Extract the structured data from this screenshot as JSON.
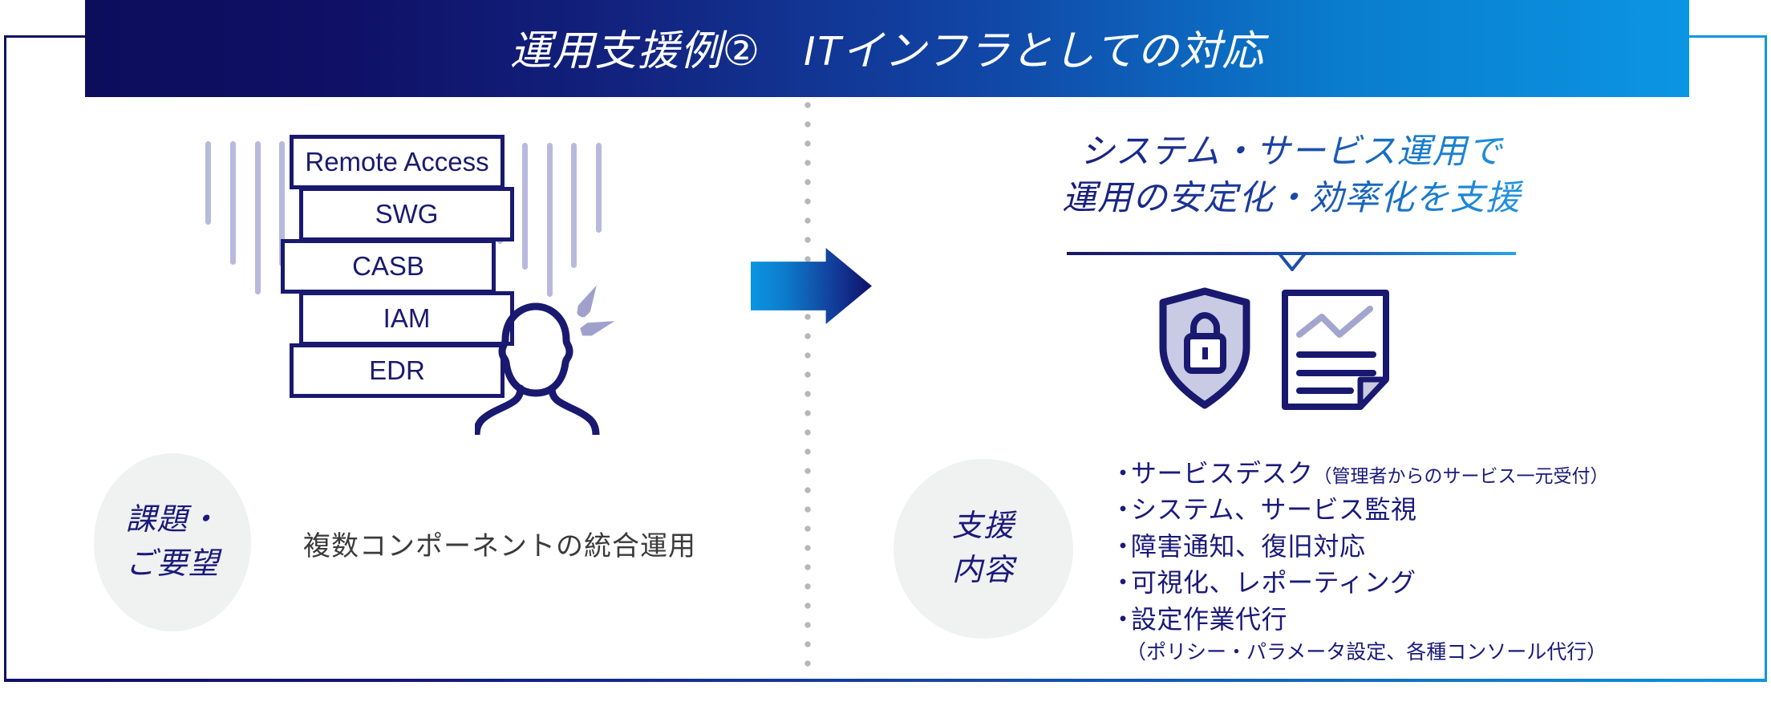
{
  "header": {
    "title": "運用支援例②　ITインフラとしての対応",
    "gradient_from": "#0d0d5c",
    "gradient_to": "#0b95e3"
  },
  "left": {
    "stack": [
      {
        "label": "Remote Access"
      },
      {
        "label": "SWG"
      },
      {
        "label": "CASB"
      },
      {
        "label": "IAM"
      },
      {
        "label": "EDR"
      }
    ],
    "circle": {
      "line1": "課題・",
      "line2": "ご要望"
    },
    "description": "複数コンポーネントの統合運用",
    "person_icon": "worried-person-icon",
    "rain_icon": "rain-lines-icon",
    "sweat_icon": "sweat-drop-icon"
  },
  "arrow": {
    "name": "right-arrow",
    "gradient_from": "#0b95e3",
    "gradient_to": "#0f1068"
  },
  "right": {
    "headline_line1": "システム・サービス運用で",
    "headline_line2": "運用の安定化・効率化を支援",
    "icons": [
      "shield-lock-icon",
      "report-document-icon"
    ],
    "circle": {
      "line1": "支援",
      "line2": "内容"
    },
    "bullets": [
      {
        "marker": "・",
        "text": "サービスデスク",
        "sub": "（管理者からのサービス一元受付）",
        "note": ""
      },
      {
        "marker": "・",
        "text": "システム、サービス監視",
        "sub": "",
        "note": ""
      },
      {
        "marker": "・",
        "text": "障害通知、復旧対応",
        "sub": "",
        "note": ""
      },
      {
        "marker": "・",
        "text": "可視化、レポーティング",
        "sub": "",
        "note": ""
      },
      {
        "marker": "・",
        "text": "設定作業代行",
        "sub": "",
        "note": "（ポリシー・パラメータ設定、各種コンソール代行）"
      }
    ]
  },
  "colors": {
    "navy": "#191970",
    "deep_navy": "#0d0d5c",
    "bright_blue": "#0b95e3",
    "lavender": "#b8b9dd",
    "circle_gray": "#f0f1f1",
    "body_gray": "#3b3b3b"
  }
}
